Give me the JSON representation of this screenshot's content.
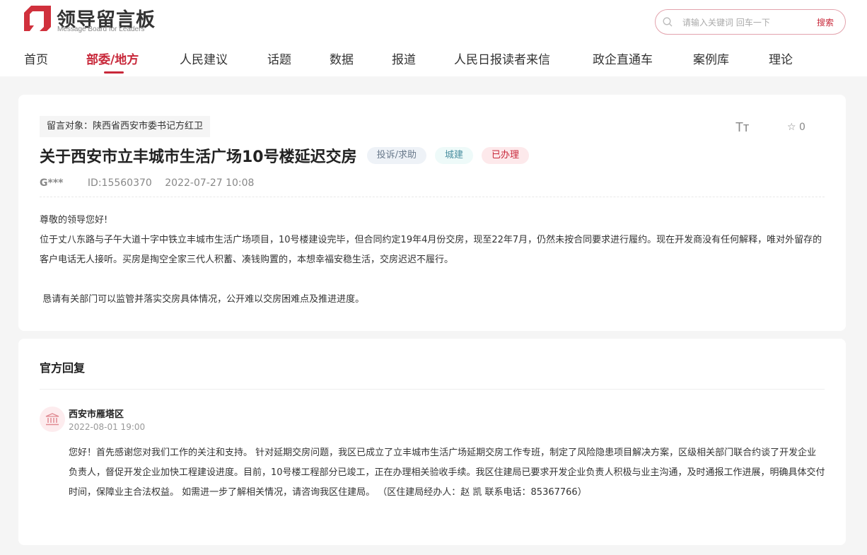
{
  "header": {
    "logo_title": "领导留言板",
    "logo_subtitle": "Message Board for Leaders",
    "search_placeholder": "请输入关键词 回车一下",
    "search_button": "搜索",
    "nav": [
      "首页",
      "部委/地方",
      "人民建议",
      "话题",
      "数据",
      "报道",
      "人民日报读者来信",
      "政企直通车",
      "案例库",
      "理论"
    ],
    "active_nav": "部委/地方"
  },
  "message": {
    "target": "留言对象：陕西省西安市委书记方红卫",
    "font_size_icon_label": "Tт",
    "favorite_count": "0",
    "title": "关于西安市立丰城市生活广场10号楼延迟交房",
    "tags": [
      "投诉/求助",
      "城建",
      "已办理"
    ],
    "user": "G***",
    "id": "ID:15560370",
    "time": "2022-07-27 10:08",
    "paragraphs": [
      "尊敬的领导您好!",
      "位于丈八东路与子午大道十字中铁立丰城市生活广场项目，10号楼建设完毕，但合同约定19年4月份交房，现至22年7月，仍然未按合同要求进行履约。现在开发商没有任何解释，唯对外留存的客户电话无人接听。买房是掏空全家三代人积蓄、凑钱购置的，本想幸福安稳生活，交房迟迟不履行。",
      "",
      " 恳请有关部门可以监管并落实交房具体情况，公开难以交房困难点及推进进度。"
    ]
  },
  "reply": {
    "section_title": "官方回复",
    "org": "西安市雁塔区",
    "time": "2022-08-01 19:00",
    "content": "您好！首先感谢您对我们工作的关注和支持。 针对延期交房问题，我区已成立了立丰城市生活广场延期交房工作专班，制定了风险隐患项目解决方案，区级相关部门联合约谈了开发企业负责人，督促开发企业加快工程建设进度。目前，10号楼工程部分已竣工，正在办理相关验收手续。我区住建局已要求开发企业负责人积极与业主沟通，及时通报工作进展，明确具体交付时间，保障业主合法权益。 如需进一步了解相关情况，请咨询我区住建局。 （区住建局经办人：赵 凯 联系电话：85367766）"
  },
  "colors": {
    "brand": "#c8283a",
    "background": "#f5f5f5"
  }
}
